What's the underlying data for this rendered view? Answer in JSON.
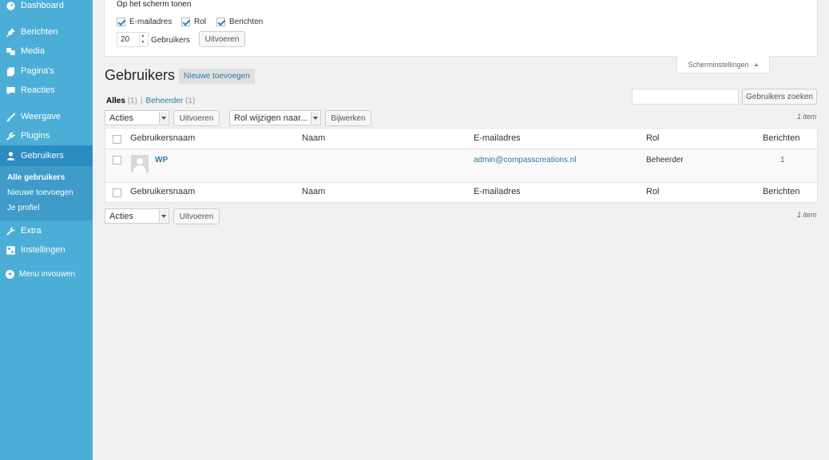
{
  "sidebar": {
    "items": [
      {
        "label": "Dashboard",
        "icon": "dashboard-icon"
      },
      {
        "label": "Berichten",
        "icon": "pin-icon"
      },
      {
        "label": "Media",
        "icon": "media-icon"
      },
      {
        "label": "Pagina's",
        "icon": "pages-icon"
      },
      {
        "label": "Reacties",
        "icon": "comment-icon"
      },
      {
        "label": "Weergave",
        "icon": "brush-icon"
      },
      {
        "label": "Plugins",
        "icon": "plugin-icon"
      },
      {
        "label": "Gebruikers",
        "icon": "user-icon"
      },
      {
        "label": "Extra",
        "icon": "wrench-icon"
      },
      {
        "label": "Instellingen",
        "icon": "settings-icon"
      }
    ],
    "submenu": [
      "Alle gebruikers",
      "Nieuwe toevoegen",
      "Je profiel"
    ],
    "collapse_label": "Menu invouwen"
  },
  "screen_options": {
    "title": "Op het scherm tonen",
    "columns": [
      "E-mailadres",
      "Rol",
      "Berichten"
    ],
    "per_page_value": "20",
    "per_page_label": "Gebruikers",
    "apply_label": "Uitvoeren",
    "tab_label": "Scherminstellingen"
  },
  "header": {
    "title": "Gebruikers",
    "add_new_label": "Nieuwe toevoegen"
  },
  "filters": {
    "all_label": "Alles",
    "all_count": "(1)",
    "separator": "|",
    "admin_label": "Beheerder",
    "admin_count": "(1)"
  },
  "search": {
    "value": "",
    "button_label": "Gebruikers zoeken"
  },
  "bulk": {
    "actions_label": "Acties",
    "apply_label": "Uitvoeren",
    "role_label": "Rol wijzigen naar...",
    "update_label": "Bijwerken",
    "items_count": "1 item"
  },
  "table": {
    "columns": [
      "Gebruikersnaam",
      "Naam",
      "E-mailadres",
      "Rol",
      "Berichten"
    ],
    "rows": [
      {
        "username": "WP",
        "name": "",
        "email": "admin@compasscreations.nl",
        "role": "Beheerder",
        "posts": "1"
      }
    ]
  },
  "colors": {
    "sidebar": "#4baed6",
    "sidebar_active": "#2b8cc1",
    "link": "#2a7aa8",
    "background": "#f1f1f1"
  }
}
